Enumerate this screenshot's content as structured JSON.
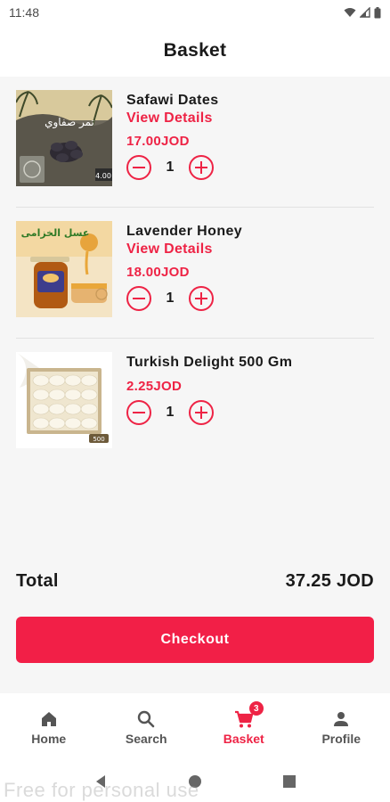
{
  "status_bar": {
    "time": "11:48"
  },
  "header": {
    "title": "Basket"
  },
  "items": [
    {
      "name": "Safawi Dates",
      "details_label": "View Details",
      "price": "17.00JOD",
      "quantity": "1",
      "image_text": "تمر صفاوي",
      "image_tag": "4.00"
    },
    {
      "name": "Lavender Honey",
      "details_label": "View Details",
      "price": "18.00JOD",
      "quantity": "1",
      "image_text": "عسل الخزامى"
    },
    {
      "name": "Turkish Delight 500 Gm",
      "price": "2.25JOD",
      "quantity": "1",
      "image_tag": "500"
    }
  ],
  "summary": {
    "total_label": "Total",
    "total_value": "37.25 JOD"
  },
  "checkout_label": "Checkout",
  "nav": [
    {
      "label": "Home",
      "icon": "home-icon"
    },
    {
      "label": "Search",
      "icon": "search-icon"
    },
    {
      "label": "Basket",
      "icon": "cart-icon",
      "badge": "3",
      "active": true
    },
    {
      "label": "Profile",
      "icon": "person-icon"
    }
  ],
  "watermark": "Free for personal use",
  "colors": {
    "accent": "#ee2345",
    "checkout": "#f21f47",
    "background": "#f6f6f6"
  }
}
